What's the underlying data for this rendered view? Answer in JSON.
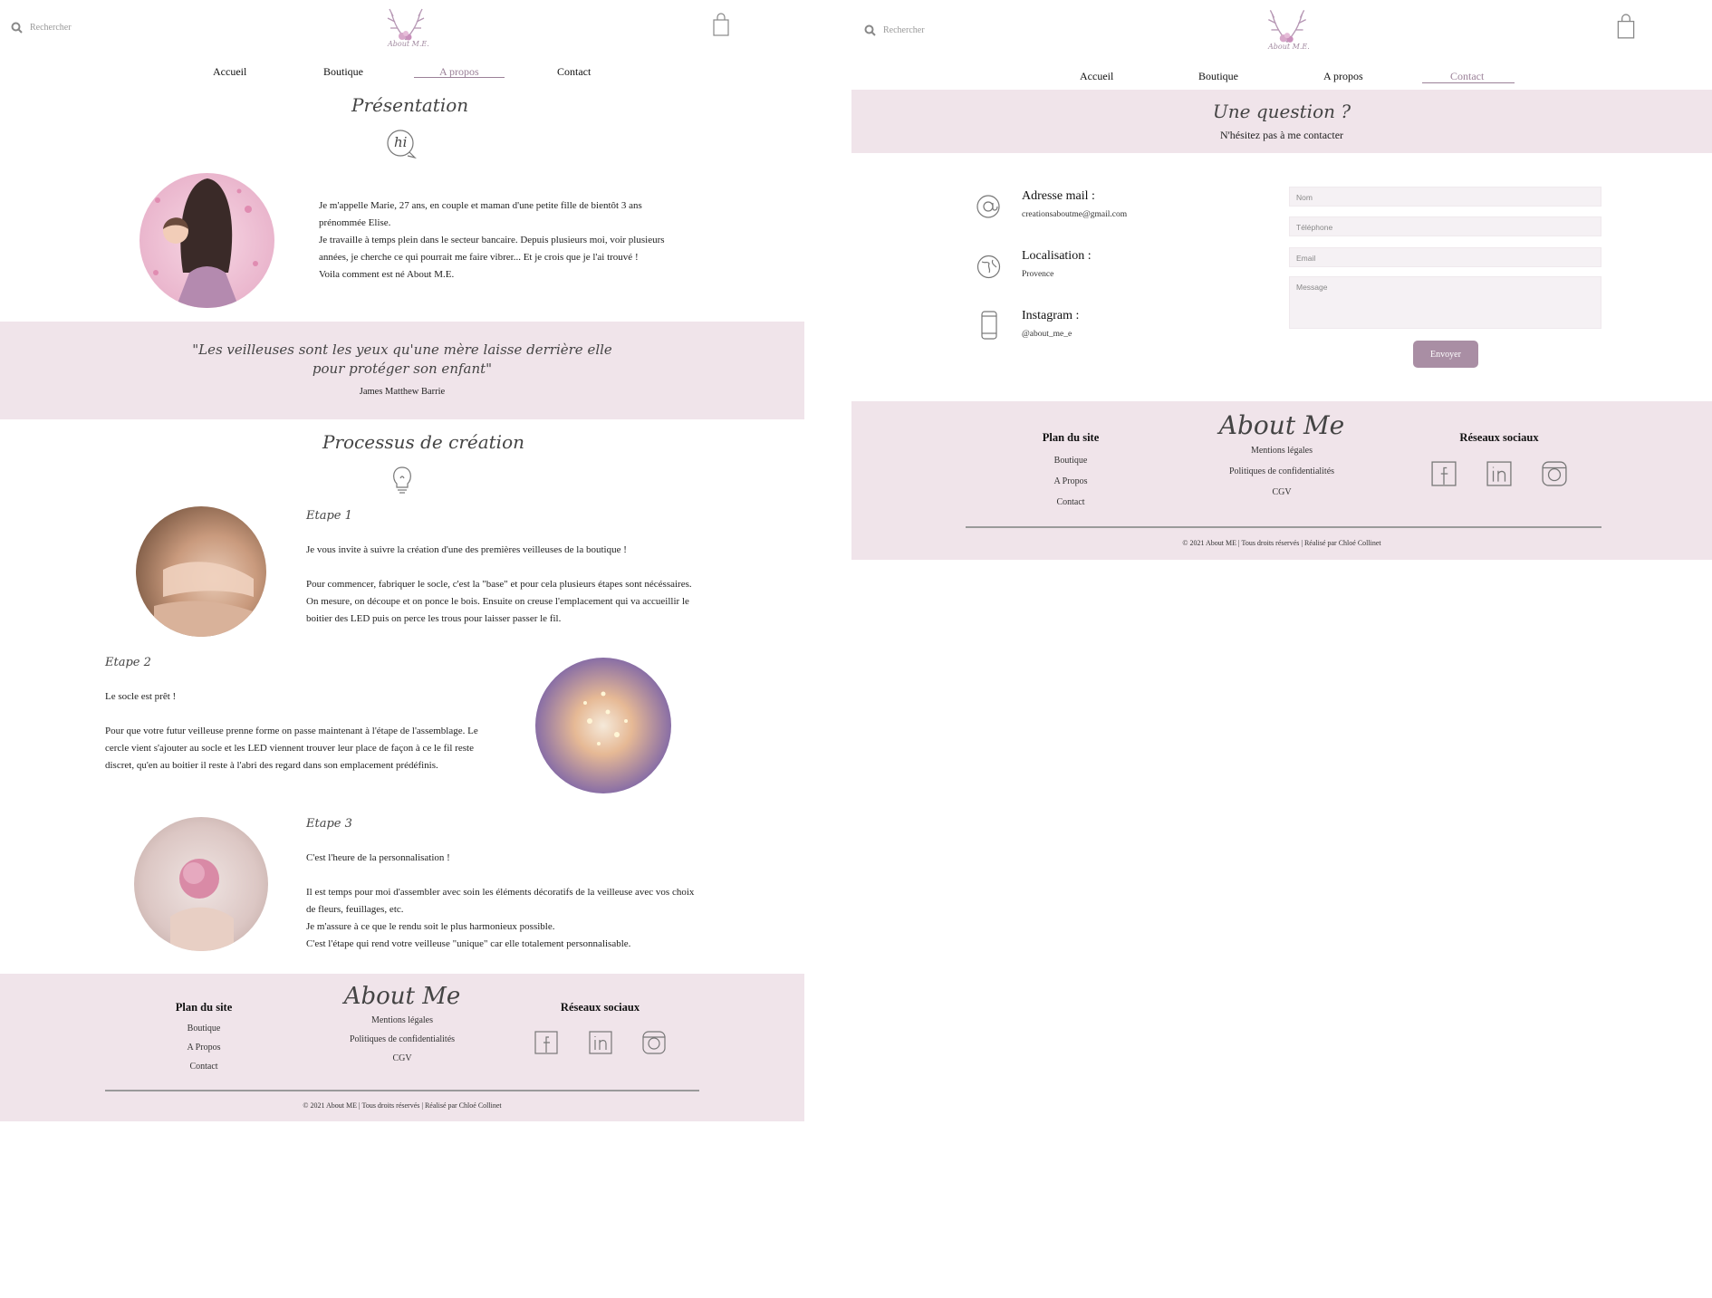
{
  "left": {
    "header": {
      "search_placeholder": "Rechercher",
      "logo_text": "About M.E."
    },
    "nav": [
      {
        "label": "Accueil"
      },
      {
        "label": "Boutique"
      },
      {
        "label": "A propos"
      },
      {
        "label": "Contact"
      }
    ],
    "presentation": {
      "title": "Présentation",
      "icon_text": "hi",
      "paragraph": [
        "Je m'appelle Marie, 27 ans, en couple et maman d'une petite fille de bientôt 3 ans prénommée Elise.",
        "Je travaille à temps plein dans le secteur bancaire. Depuis plusieurs moi, voir plusieurs années, je cherche ce qui pourrait me faire vibrer... Et je crois que je l'ai trouvé !",
        "Voila comment est né About M.E."
      ]
    },
    "quote": {
      "line1": "\"Les veilleuses sont les yeux qu'une mère laisse derrière elle",
      "line2": "pour protéger son enfant\"",
      "author": "James Matthew Barrie"
    },
    "process": {
      "title": "Processus de création",
      "steps": [
        {
          "label": "Etape 1",
          "intro": "Je vous invite à suivre la création d'une des premières veilleuses de la boutique !",
          "text": "Pour commencer, fabriquer le socle, c'est la \"base\" et pour cela plusieurs étapes sont nécéssaires. On mesure, on découpe et on ponce le bois. Ensuite on creuse l'emplacement qui va accueillir le boitier des LED puis on perce les trous pour laisser passer le fil."
        },
        {
          "label": "Etape 2",
          "intro": "Le socle est prêt !",
          "text": "Pour que votre futur veilleuse prenne forme on passe maintenant à l'étape de l'assemblage. Le cercle vient s'ajouter au socle et les LED viennent trouver leur place de façon à ce le fil reste discret, qu'en au boitier il reste à l'abri des regard dans son emplacement prédéfinis."
        },
        {
          "label": "Etape 3",
          "intro": "C'est l'heure de la personnalisation !",
          "text1": "Il est temps pour moi d'assembler avec soin les éléments décoratifs de la veilleuse avec vos choix de fleurs, feuillages, etc.",
          "text2": "Je m'assure à ce que le rendu soit le plus harmonieux possible.",
          "text3": "C'est l'étape qui rend votre veilleuse \"unique\" car elle totalement personnalisable."
        }
      ]
    },
    "footer": {
      "plan_title": "Plan du site",
      "plan_links": [
        "Boutique",
        "A Propos",
        "Contact"
      ],
      "brand": "About Me",
      "legal_links": [
        "Mentions légales",
        "Politiques de confidentialités",
        "CGV"
      ],
      "social_title": "Réseaux sociaux",
      "copyright": "© 2021 About ME | Tous droits réservés | Réalisé par Chloé Collinet"
    }
  },
  "right": {
    "header": {
      "search_placeholder": "Rechercher",
      "logo_text": "About M.E."
    },
    "nav": [
      {
        "label": "Accueil"
      },
      {
        "label": "Boutique"
      },
      {
        "label": "A propos"
      },
      {
        "label": "Contact"
      }
    ],
    "hero": {
      "title": "Une question ?",
      "subtitle": "N'hésitez pas à me contacter"
    },
    "contact_info": [
      {
        "label": "Adresse mail :",
        "value": "creationsaboutme@gmail.com",
        "icon": "at-icon"
      },
      {
        "label": "Localisation :",
        "value": "Provence",
        "icon": "globe-icon"
      },
      {
        "label": "Instagram :",
        "value": "@about_me_e",
        "icon": "phone-icon"
      }
    ],
    "form": {
      "name_placeholder": "Nom",
      "phone_placeholder": "Téléphone",
      "email_placeholder": "Email",
      "message_placeholder": "Message",
      "submit_label": "Envoyer"
    },
    "footer": {
      "plan_title": "Plan du site",
      "plan_links": [
        "Boutique",
        "A Propos",
        "Contact"
      ],
      "brand": "About Me",
      "legal_links": [
        "Mentions légales",
        "Politiques de confidentialités",
        "CGV"
      ],
      "social_title": "Réseaux sociaux",
      "copyright": "© 2021 About ME | Tous droits réservés | Réalisé par Chloé Collinet"
    }
  },
  "colors": {
    "band": "#f0e4ea",
    "accent": "#9b8198",
    "button": "#a98ea4"
  }
}
